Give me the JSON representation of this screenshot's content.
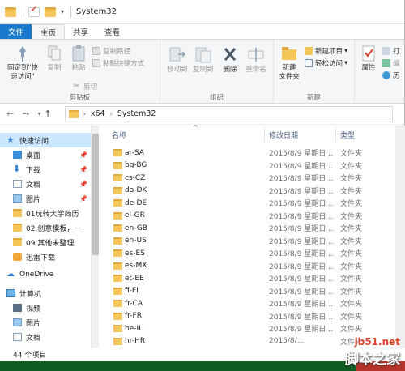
{
  "window": {
    "title": "System32"
  },
  "tabs": [
    {
      "label": "文件"
    },
    {
      "label": "主页"
    },
    {
      "label": "共享"
    },
    {
      "label": "查看"
    }
  ],
  "ribbon": {
    "clipboard": {
      "pin_label_1": "固定到\"快",
      "pin_label_2": "速访问\"",
      "copy": "复制",
      "paste": "粘贴",
      "copy_path": "复制路径",
      "paste_shortcut": "粘贴快捷方式",
      "cut": "剪切",
      "group": "剪贴板"
    },
    "organize": {
      "move_to": "移动到",
      "copy_to": "复制到",
      "delete": "删除",
      "rename": "重命名",
      "group": "组织"
    },
    "new": {
      "new_folder_1": "新建",
      "new_folder_2": "文件夹",
      "new_item": "新建项目",
      "easy_access": "轻松访问",
      "group": "新建"
    },
    "open": {
      "properties": "属性",
      "open": "打",
      "edit": "编",
      "history": "历"
    }
  },
  "address": {
    "crumbs": [
      "x64",
      "System32"
    ]
  },
  "nav": {
    "items": [
      {
        "label": "快速访问",
        "icon": "star-icon"
      },
      {
        "label": "桌面",
        "icon": "desktop-icon"
      },
      {
        "label": "下载",
        "icon": "download-icon"
      },
      {
        "label": "文档",
        "icon": "document-icon"
      },
      {
        "label": "图片",
        "icon": "picture-icon"
      },
      {
        "label": "01玩转大学简历",
        "icon": "folder-icon"
      },
      {
        "label": "02.创意模板，一",
        "icon": "folder-icon"
      },
      {
        "label": "09.其他未整理",
        "icon": "folder-icon"
      },
      {
        "label": "迅雷下载",
        "icon": "thunder-icon"
      },
      {
        "label": "OneDrive",
        "icon": "cloud-icon"
      },
      {
        "label": "计算机",
        "icon": "computer-icon"
      },
      {
        "label": "视频",
        "icon": "video-icon"
      },
      {
        "label": "图片",
        "icon": "picture-icon"
      },
      {
        "label": "文档",
        "icon": "document-icon"
      }
    ]
  },
  "columns": {
    "name": "名称",
    "date": "修改日期",
    "type": "类型"
  },
  "files": [
    {
      "name": "ar-SA",
      "date": "2015/8/9 星期日 ...",
      "type": "文件夹"
    },
    {
      "name": "bg-BG",
      "date": "2015/8/9 星期日 ...",
      "type": "文件夹"
    },
    {
      "name": "cs-CZ",
      "date": "2015/8/9 星期日 ...",
      "type": "文件夹"
    },
    {
      "name": "da-DK",
      "date": "2015/8/9 星期日 ...",
      "type": "文件夹"
    },
    {
      "name": "de-DE",
      "date": "2015/8/9 星期日 ...",
      "type": "文件夹"
    },
    {
      "name": "el-GR",
      "date": "2015/8/9 星期日 ...",
      "type": "文件夹"
    },
    {
      "name": "en-GB",
      "date": "2015/8/9 星期日 ...",
      "type": "文件夹"
    },
    {
      "name": "en-US",
      "date": "2015/8/9 星期日 ...",
      "type": "文件夹"
    },
    {
      "name": "es-ES",
      "date": "2015/8/9 星期日 ...",
      "type": "文件夹"
    },
    {
      "name": "es-MX",
      "date": "2015/8/9 星期日 ...",
      "type": "文件夹"
    },
    {
      "name": "et-EE",
      "date": "2015/8/9 星期日 ...",
      "type": "文件夹"
    },
    {
      "name": "fi-FI",
      "date": "2015/8/9 星期日 ...",
      "type": "文件夹"
    },
    {
      "name": "fr-CA",
      "date": "2015/8/9 星期日 ...",
      "type": "文件夹"
    },
    {
      "name": "fr-FR",
      "date": "2015/8/9 星期日 ...",
      "type": "文件夹"
    },
    {
      "name": "he-IL",
      "date": "2015/8/9 星期日 ...",
      "type": "文件夹"
    },
    {
      "name": "hr-HR",
      "date": "2015/8/...",
      "type": "文件夹"
    }
  ],
  "status": {
    "count": "44 个项目"
  },
  "watermark": {
    "site": "jb51.net",
    "name": "脚本之家"
  },
  "colors": {
    "accent": "#1979ca",
    "folder": "#f5c65a",
    "selected": "#cce8ff"
  }
}
